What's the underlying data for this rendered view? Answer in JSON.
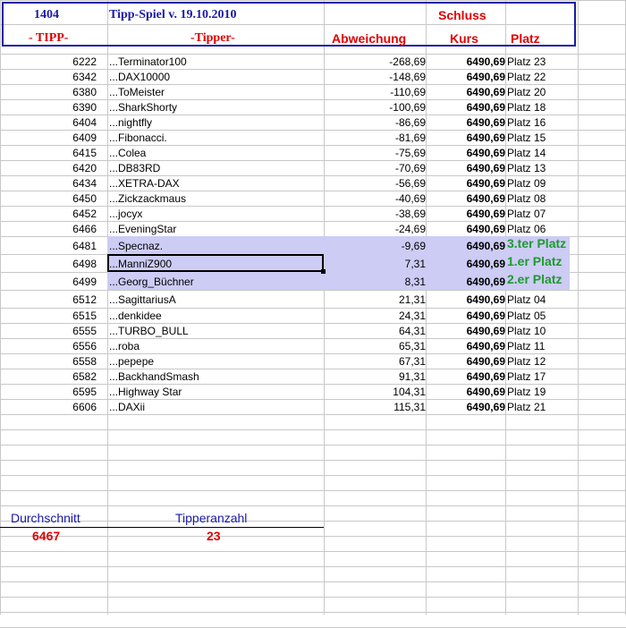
{
  "header": {
    "id": "1404",
    "title": "Tipp-Spiel v. 19.10.2010",
    "schluss": "Schluss",
    "tipp_label": "- TIPP-",
    "tipper_label": "-Tipper-",
    "abweichung_label": "Abweichung",
    "kurs_label": "Kurs",
    "platz_label": "Platz"
  },
  "rows": [
    {
      "tipp": "6222",
      "name": "...Terminator100",
      "abw": "-268,69",
      "kurs": "6490,69",
      "platz": "Platz 23"
    },
    {
      "tipp": "6342",
      "name": "...DAX10000",
      "abw": "-148,69",
      "kurs": "6490,69",
      "platz": "Platz 22"
    },
    {
      "tipp": "6380",
      "name": "...ToMeister",
      "abw": "-110,69",
      "kurs": "6490,69",
      "platz": "Platz 20"
    },
    {
      "tipp": "6390",
      "name": "...SharkShorty",
      "abw": "-100,69",
      "kurs": "6490,69",
      "platz": "Platz 18"
    },
    {
      "tipp": "6404",
      "name": "...nightfly",
      "abw": "-86,69",
      "kurs": "6490,69",
      "platz": "Platz 16"
    },
    {
      "tipp": "6409",
      "name": "...Fibonacci.",
      "abw": "-81,69",
      "kurs": "6490,69",
      "platz": "Platz 15"
    },
    {
      "tipp": "6415",
      "name": "...Colea",
      "abw": "-75,69",
      "kurs": "6490,69",
      "platz": "Platz 14"
    },
    {
      "tipp": "6420",
      "name": "...DB83RD",
      "abw": "-70,69",
      "kurs": "6490,69",
      "platz": "Platz 13"
    },
    {
      "tipp": "6434",
      "name": "...XETRA-DAX",
      "abw": "-56,69",
      "kurs": "6490,69",
      "platz": "Platz 09"
    },
    {
      "tipp": "6450",
      "name": "...Zickzackmaus",
      "abw": "-40,69",
      "kurs": "6490,69",
      "platz": "Platz 08"
    },
    {
      "tipp": "6452",
      "name": "...jocyx",
      "abw": "-38,69",
      "kurs": "6490,69",
      "platz": "Platz 07"
    },
    {
      "tipp": "6466",
      "name": "...EveningStar",
      "abw": "-24,69",
      "kurs": "6490,69",
      "platz": "Platz 06"
    },
    {
      "tipp": "6481",
      "name": "...Specnaz.",
      "abw": "-9,69",
      "kurs": "6490,69",
      "platz": "3.ter Platz",
      "winner": true
    },
    {
      "tipp": "6498",
      "name": "...ManniZ900",
      "abw": "7,31",
      "kurs": "6490,69",
      "platz": "1.er Platz",
      "winner": true
    },
    {
      "tipp": "6499",
      "name": "...Georg_Büchner",
      "abw": "8,31",
      "kurs": "6490,69",
      "platz": "2.er Platz",
      "winner": true
    },
    {
      "tipp": "6512",
      "name": "...SagittariusA",
      "abw": "21,31",
      "kurs": "6490,69",
      "platz": "Platz 04"
    },
    {
      "tipp": "6515",
      "name": "...denkidee",
      "abw": "24,31",
      "kurs": "6490,69",
      "platz": "Platz 05"
    },
    {
      "tipp": "6555",
      "name": "...TURBO_BULL",
      "abw": "64,31",
      "kurs": "6490,69",
      "platz": "Platz 10"
    },
    {
      "tipp": "6556",
      "name": "...roba",
      "abw": "65,31",
      "kurs": "6490,69",
      "platz": "Platz 11"
    },
    {
      "tipp": "6558",
      "name": "...pepepe",
      "abw": "67,31",
      "kurs": "6490,69",
      "platz": "Platz 12"
    },
    {
      "tipp": "6582",
      "name": "...BackhandSmash",
      "abw": "91,31",
      "kurs": "6490,69",
      "platz": "Platz 17"
    },
    {
      "tipp": "6595",
      "name": "...Highway Star",
      "abw": "104,31",
      "kurs": "6490,69",
      "platz": "Platz 19"
    },
    {
      "tipp": "6606",
      "name": "...DAXii",
      "abw": "115,31",
      "kurs": "6490,69",
      "platz": "Platz 21"
    }
  ],
  "footer": {
    "durchschnitt_label": "Durchschnitt",
    "durchschnitt_value": "6467",
    "tipperanzahl_label": "Tipperanzahl",
    "tipperanzahl_value": "23"
  },
  "colors": {
    "navy": "#1a1aa8",
    "red": "#e00000",
    "highlight": "#ccccf5",
    "winner_green": "#1f9a2f"
  }
}
